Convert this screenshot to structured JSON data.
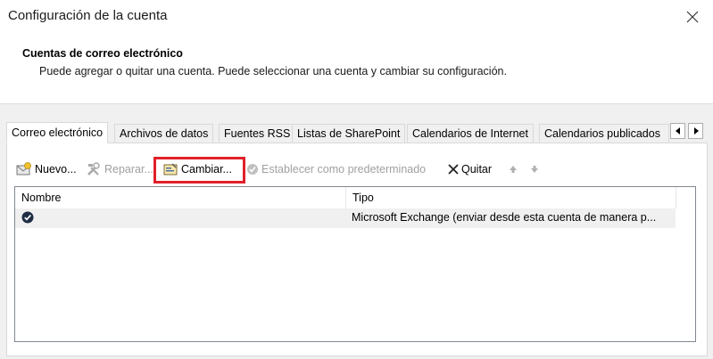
{
  "window": {
    "title": "Configuración de la cuenta"
  },
  "header": {
    "title": "Cuentas de correo electrónico",
    "description": "Puede agregar o quitar una cuenta. Puede seleccionar una cuenta y cambiar su configuración."
  },
  "tabs": [
    {
      "label": "Correo electrónico",
      "active": true
    },
    {
      "label": "Archivos de datos"
    },
    {
      "label": "Fuentes RSS"
    },
    {
      "label": "Listas de SharePoint"
    },
    {
      "label": "Calendarios de Internet"
    },
    {
      "label": "Calendarios publicados"
    }
  ],
  "toolbar": {
    "new_label": "Nuevo...",
    "repair_label": "Reparar...",
    "change_label": "Cambiar...",
    "set_default_label": "Establecer como predeterminado",
    "remove_label": "Quitar"
  },
  "list": {
    "columns": [
      "Nombre",
      "Tipo"
    ],
    "rows": [
      {
        "name": "",
        "type": "Microsoft Exchange (enviar desde esta cuenta de manera p..."
      }
    ]
  },
  "colors": {
    "highlight": "#e0202a",
    "default_check": "#1f2d44"
  }
}
